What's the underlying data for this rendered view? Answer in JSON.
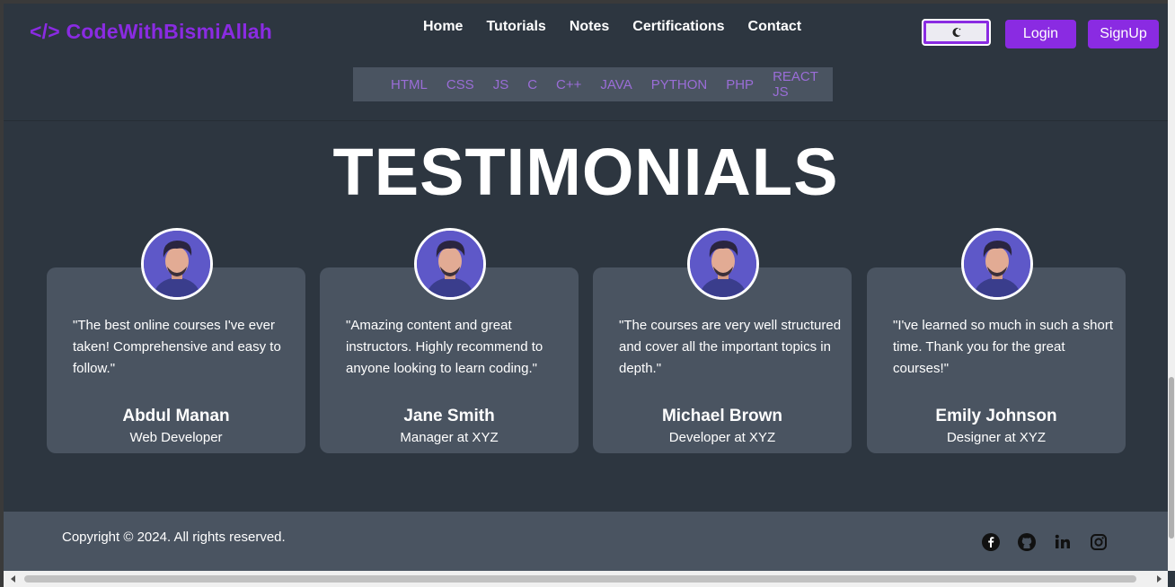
{
  "brand": {
    "symbol": "</>",
    "name": "CodeWithBismiAllah",
    "color": "#8a2be2"
  },
  "nav": {
    "links": [
      "Home",
      "Tutorials",
      "Notes",
      "Certifications",
      "Contact"
    ]
  },
  "actions": {
    "login": "Login",
    "signup": "SignUp",
    "theme_icon": "moon-icon"
  },
  "subnav": {
    "items": [
      "HTML",
      "CSS",
      "JS",
      "C",
      "C++",
      "JAVA",
      "PYTHON",
      "PHP",
      "REACT JS"
    ]
  },
  "page": {
    "heading": "TESTIMONIALS"
  },
  "testimonials": [
    {
      "quote": "\"The best online courses I've ever taken! Comprehensive and easy to follow.\"",
      "name": "Abdul Manan",
      "role": "Web Developer"
    },
    {
      "quote": "\"Amazing content and great instructors. Highly recommend to anyone looking to learn coding.\"",
      "name": "Jane Smith",
      "role": "Manager at XYZ"
    },
    {
      "quote": "\"The courses are very well structured and cover all the important topics in depth.\"",
      "name": "Michael Brown",
      "role": "Developer at XYZ"
    },
    {
      "quote": "\"I've learned so much in such a short time. Thank you for the great courses!\"",
      "name": "Emily Johnson",
      "role": "Designer at XYZ"
    }
  ],
  "footer": {
    "copyright": "Copyright © 2024. All rights reserved.",
    "social_icons": [
      "facebook-icon",
      "github-icon",
      "linkedin-icon",
      "instagram-icon"
    ]
  },
  "colors": {
    "accent": "#8a2be2",
    "background": "#2d3640",
    "card": "#4a5461"
  }
}
